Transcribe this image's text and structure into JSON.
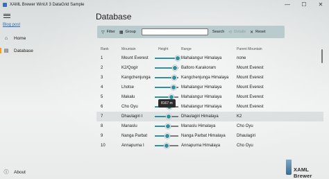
{
  "window": {
    "title": "XAML Brewer WinUI 3 DataGrid Sample",
    "minimize": "—",
    "maximize": "☐",
    "close": "✕"
  },
  "nav": {
    "blog_link": "Blog post",
    "items": [
      {
        "label": "Home",
        "icon": "home-icon",
        "glyph": "⌂"
      },
      {
        "label": "Database",
        "icon": "database-icon",
        "glyph": "▤"
      }
    ],
    "about": {
      "label": "About",
      "icon": "info-icon",
      "glyph": "ⓘ"
    }
  },
  "page": {
    "title": "Database"
  },
  "toolbar": {
    "filter_label": "Filter",
    "group_label": "Group",
    "search_value": "",
    "search_label": "Search",
    "details_label": "Details",
    "reset_label": "Reset"
  },
  "grid": {
    "headers": {
      "rank": "Rank",
      "mountain": "Mountain",
      "height": "Height",
      "range": "Range",
      "parent": "Parent Mountain"
    },
    "tooltip": "8167 m",
    "rows": [
      {
        "rank": "1",
        "mountain": "Mount Everest",
        "height_fraction": 0.98,
        "range": "Mahalangur Himalaya",
        "parent": "none"
      },
      {
        "rank": "2",
        "mountain": "K2/Qogir",
        "height_fraction": 0.86,
        "range": "Baltoro Karakoram",
        "parent": "Mount Everest"
      },
      {
        "rank": "3",
        "mountain": "Kangchenjunga",
        "height_fraction": 0.82,
        "range": "Kangchenjunga Himalaya",
        "parent": "Mount Everest"
      },
      {
        "rank": "4",
        "mountain": "Lhotse",
        "height_fraction": 0.78,
        "range": "Mahalangur Himalaya",
        "parent": "Mount Everest"
      },
      {
        "rank": "5",
        "mountain": "Makalu",
        "height_fraction": 0.72,
        "range": "Mahalangur Himalaya",
        "parent": "Mount Everest"
      },
      {
        "rank": "6",
        "mountain": "Cho Oyu",
        "height_fraction": 0.62,
        "range": "Mahalangur Himalaya",
        "parent": "Mount Everest"
      },
      {
        "rank": "7",
        "mountain": "Dhaulagiri I",
        "height_fraction": 0.6,
        "range": "Dhaulagiri Himalaya",
        "parent": "K2"
      },
      {
        "rank": "8",
        "mountain": "Manaslu",
        "height_fraction": 0.56,
        "range": "Manaslu Himalaya",
        "parent": "Cho Oyu"
      },
      {
        "rank": "9",
        "mountain": "Nanga Parbat",
        "height_fraction": 0.54,
        "range": "Nanga Parbat Himalaya",
        "parent": "Dhaulagiri"
      },
      {
        "rank": "10",
        "mountain": "Annapurna I",
        "height_fraction": 0.5,
        "range": "Annapurna Himalaya",
        "parent": "Cho Oyu"
      }
    ]
  },
  "brand": {
    "label": "XAML Brewer"
  },
  "colors": {
    "accent": "#2e8fa0",
    "selection": "#f0a020",
    "toolbar": "#b0c6c8"
  }
}
